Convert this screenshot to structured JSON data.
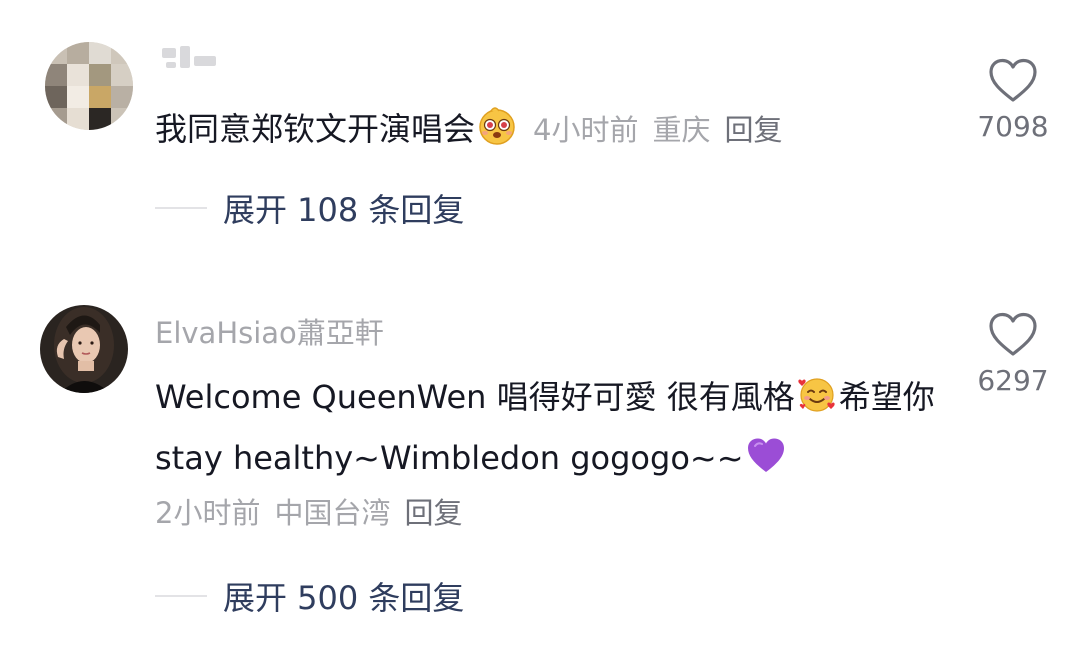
{
  "comments": [
    {
      "username": "",
      "text": "我同意郑钦文开演唱会",
      "emoji": "pleading-face-emoji",
      "time": "4小时前",
      "location": "重庆",
      "reply_label": "回复",
      "likes": "7098",
      "expand_label": "展开 108 条回复"
    },
    {
      "username": "ElvaHsiao蕭亞軒",
      "text_part1": "Welcome QueenWen 唱得好可愛 很有風格",
      "emoji1": "smiling-face-with-hearts-emoji",
      "text_part2": "希望你stay healthy~Wimbledon gogogo~~",
      "emoji2": "purple-heart-emoji",
      "time": "2小时前",
      "location": "中国台湾",
      "reply_label": "回复",
      "likes": "6297",
      "expand_label": "展开 500 条回复"
    }
  ],
  "colors": {
    "text": "#161823",
    "meta": "#a5a6ab",
    "link": "#2f3d5e",
    "icon": "#6e7079"
  }
}
